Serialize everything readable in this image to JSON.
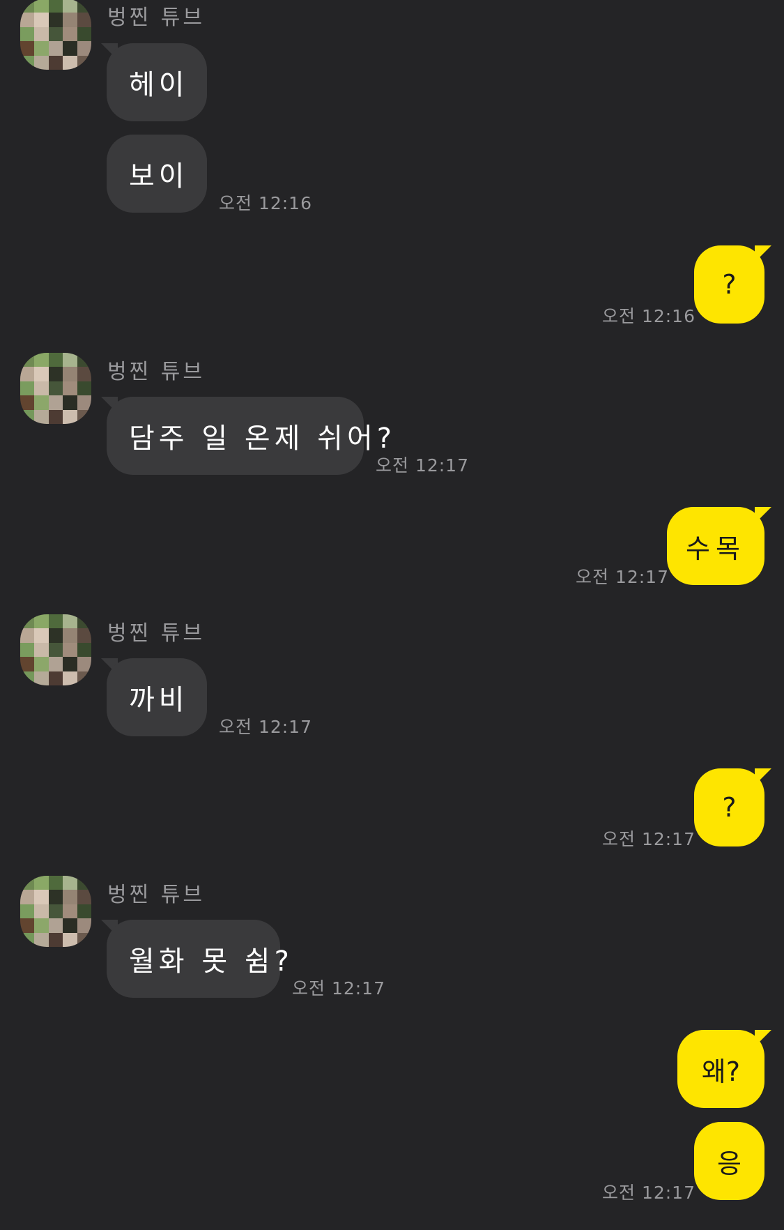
{
  "sender_name": "벙찐 튜브",
  "colors": {
    "background": "#242426",
    "incoming_bubble": "#3a3a3c",
    "outgoing_bubble": "#fee500",
    "meta_text": "#9a9a9d"
  },
  "messages": [
    {
      "side": "in",
      "text": "헤이",
      "time": ""
    },
    {
      "side": "in",
      "text": "보이",
      "time": "오전 12:16"
    },
    {
      "side": "out",
      "text": "?",
      "time": "오전 12:16"
    },
    {
      "side": "in",
      "text": "담주 일 온제 쉬어?",
      "time": "오전 12:17"
    },
    {
      "side": "out",
      "text": "수목",
      "time": "오전 12:17"
    },
    {
      "side": "in",
      "text": "까비",
      "time": "오전 12:17"
    },
    {
      "side": "out",
      "text": "?",
      "time": "오전 12:17"
    },
    {
      "side": "in",
      "text": "월화 못 쉼?",
      "time": "오전 12:17"
    },
    {
      "side": "out",
      "text": "왜?",
      "time": ""
    },
    {
      "side": "out",
      "text": "응",
      "time": "오전 12:17"
    }
  ]
}
